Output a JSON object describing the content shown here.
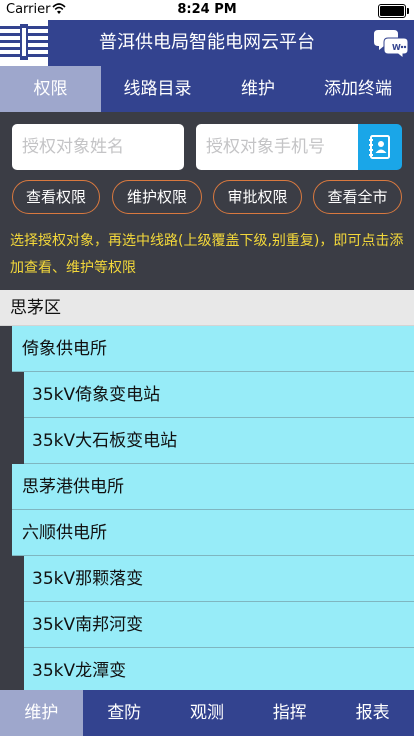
{
  "status_bar": {
    "carrier": "Carrier",
    "time": "8:24 PM"
  },
  "header": {
    "title": "普洱供电局智能电网云平台",
    "logo_icon": "logo-icon",
    "chat_icon": "chat-bubbles-icon"
  },
  "tabs": [
    {
      "label": "权限",
      "active": true
    },
    {
      "label": "线路目录",
      "active": false
    },
    {
      "label": "维护",
      "active": false
    },
    {
      "label": "添加终端",
      "active": false
    }
  ],
  "search": {
    "name_placeholder": "授权对象姓名",
    "phone_placeholder": "授权对象手机号",
    "contact_icon": "address-book-icon"
  },
  "actions": [
    {
      "label": "查看权限"
    },
    {
      "label": "维护权限"
    },
    {
      "label": "审批权限"
    },
    {
      "label": "查看全市"
    }
  ],
  "hint": "选择授权对象，再选中线路(上级覆盖下级,别重复)，即可点击添加查看、维护等权限",
  "tree": {
    "district": "思茅区",
    "items": [
      {
        "label": "倚象供电所",
        "level": 1
      },
      {
        "label": "35kV倚象变电站",
        "level": 2
      },
      {
        "label": "35kV大石板变电站",
        "level": 2
      },
      {
        "label": "思茅港供电所",
        "level": 1
      },
      {
        "label": "六顺供电所",
        "level": 1
      },
      {
        "label": "35kV那颗落变",
        "level": 2
      },
      {
        "label": "35kV南邦河变",
        "level": 2
      },
      {
        "label": "35kV龙潭变",
        "level": 2
      }
    ]
  },
  "bottom_nav": [
    {
      "label": "维护",
      "active": true
    },
    {
      "label": "查防",
      "active": false
    },
    {
      "label": "观测",
      "active": false
    },
    {
      "label": "指挥",
      "active": false
    },
    {
      "label": "报表",
      "active": false
    }
  ],
  "colors": {
    "primary": "#33438f",
    "tab_active": "#9ea7cc",
    "tree_bg": "#97ecf8",
    "hint_text": "#f3d83a",
    "button_border": "#d9793f",
    "contact_button": "#1aa6e8"
  }
}
